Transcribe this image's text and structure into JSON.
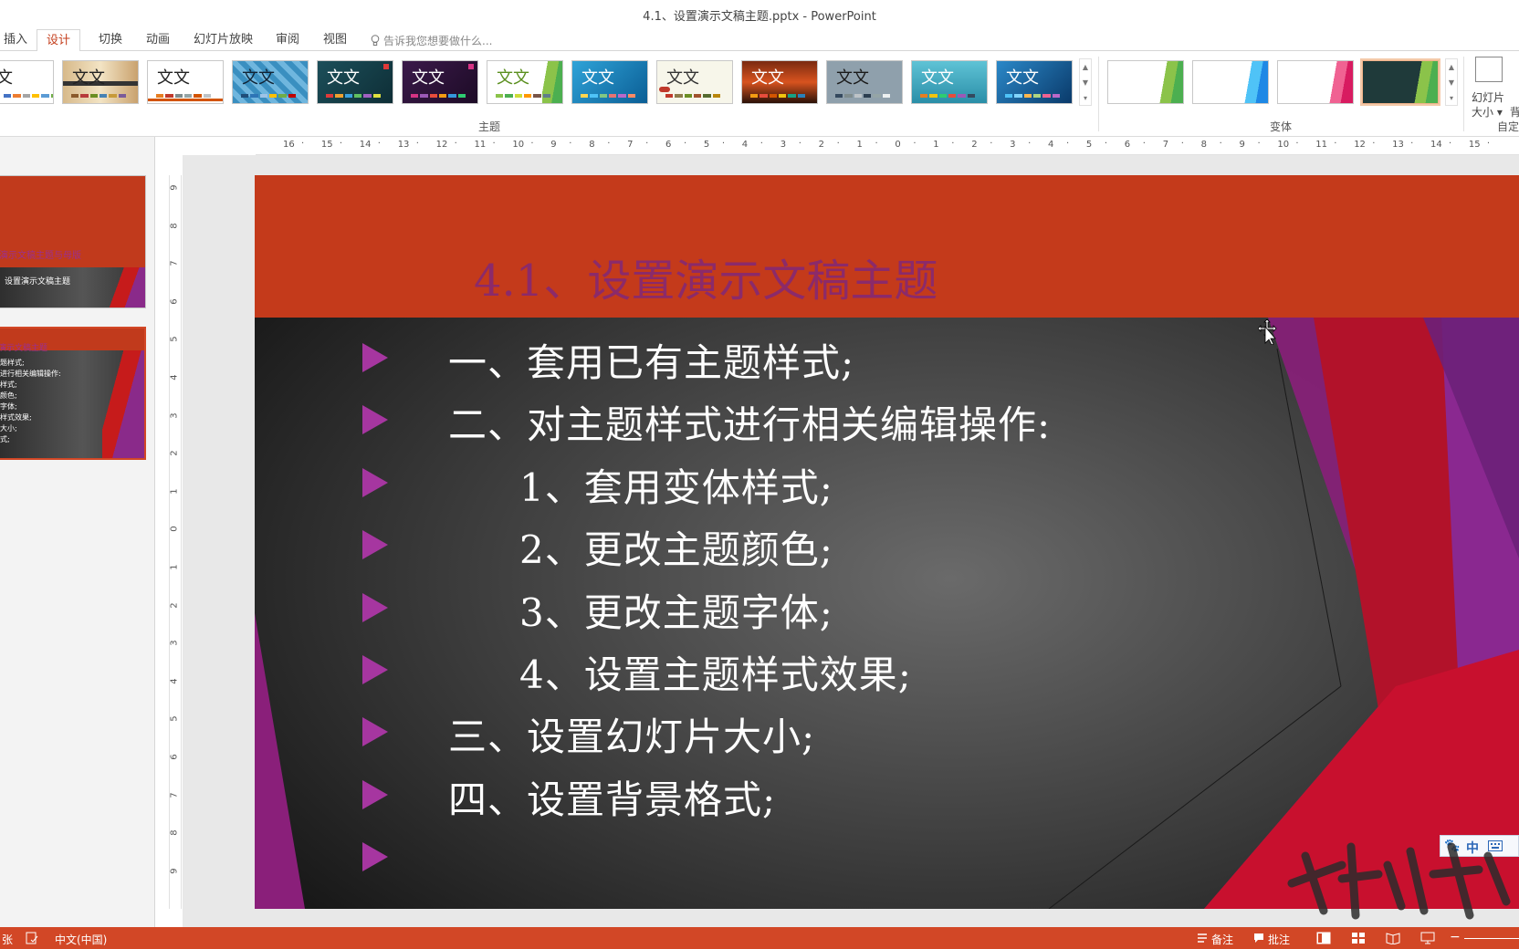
{
  "window": {
    "title": "4.1、设置演示文稿主题.pptx - PowerPoint"
  },
  "tabs": [
    {
      "label": "插入"
    },
    {
      "label": "设计"
    },
    {
      "label": "切换"
    },
    {
      "label": "动画"
    },
    {
      "label": "幻灯片放映"
    },
    {
      "label": "审阅"
    },
    {
      "label": "视图"
    }
  ],
  "tell_me": {
    "placeholder": "告诉我您想要做什么..."
  },
  "ribbon": {
    "themes_group_label": "主题",
    "variants_group_label": "变体",
    "customize_group_label": "自定",
    "theme_thumb_text": "文文",
    "theme_thumb_text_short": "文",
    "slide_size_label_1": "幻灯片",
    "slide_size_label_2": "大小 ▾",
    "format_bg_label_1": "",
    "format_bg_label_2": "背"
  },
  "thumbnails": [
    {
      "line1": "演示文稿主题与母版",
      "line2": "设置演示文稿主题"
    },
    {
      "title": "演示文稿主题",
      "lines": [
        "题样式;",
        "进行相关编辑操作:",
        "样式;",
        "颜色;",
        "字体;",
        "样式效果;",
        "大小;",
        "式;"
      ]
    }
  ],
  "ruler": {
    "horizontal": [
      "16",
      "15",
      "14",
      "13",
      "12",
      "11",
      "10",
      "9",
      "8",
      "7",
      "6",
      "5",
      "4",
      "3",
      "2",
      "1",
      "0",
      "1",
      "2",
      "3",
      "4",
      "5",
      "6",
      "7",
      "8",
      "9",
      "10",
      "11",
      "12",
      "13",
      "14",
      "15"
    ],
    "vertical": [
      "9",
      "8",
      "7",
      "6",
      "5",
      "4",
      "3",
      "2",
      "1",
      "0",
      "1",
      "2",
      "3",
      "4",
      "5",
      "6",
      "7",
      "8",
      "9"
    ]
  },
  "slide": {
    "title": "4.1、设置演示文稿主题",
    "bullets": [
      "一、套用已有主题样式;",
      "二、对主题样式进行相关编辑操作:",
      "1、套用变体样式;",
      "2、更改主题颜色;",
      "3、更改主题字体;",
      "4、设置主题样式效果;",
      "三、设置幻灯片大小;",
      "四、设置背景格式;",
      ""
    ]
  },
  "ime": {
    "mode": "中"
  },
  "statusbar": {
    "slide_info": "张",
    "language": "中文(中国)",
    "notes": "备注",
    "comments": "批注"
  },
  "colors": {
    "accent": "#d24726",
    "title_band": "#c43a1b",
    "slide_title_text": "#8b2a6a",
    "bullet_arrow": "#a636a0"
  }
}
